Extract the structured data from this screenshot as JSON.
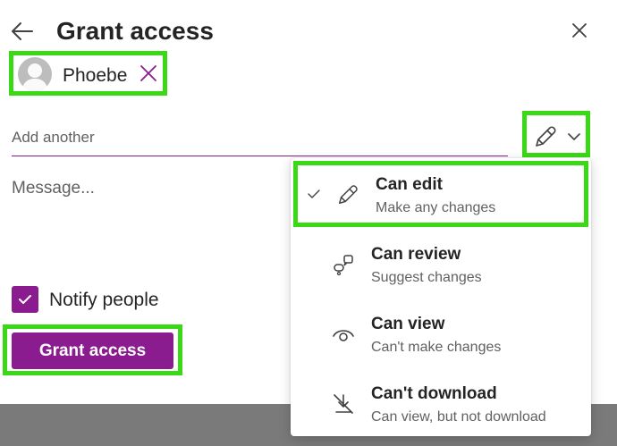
{
  "dialog": {
    "title": "Grant access",
    "back_icon": "arrow-left-icon",
    "close_icon": "close-icon"
  },
  "recipient": {
    "name": "Phoebe",
    "avatar_icon": "person-avatar-icon",
    "remove_icon": "remove-x-icon"
  },
  "add_input": {
    "placeholder": "Add another",
    "value": ""
  },
  "permission_button": {
    "icon": "pencil-icon",
    "dropdown_icon": "chevron-down-icon"
  },
  "message": {
    "placeholder": "Message...",
    "value": ""
  },
  "notify": {
    "label": "Notify people",
    "checked": true
  },
  "grant_button": {
    "label": "Grant access"
  },
  "permission_menu": {
    "items": [
      {
        "label": "Can edit",
        "description": "Make any changes",
        "icon": "pencil-icon",
        "selected": true
      },
      {
        "label": "Can review",
        "description": "Suggest changes",
        "icon": "review-shapes-icon",
        "selected": false
      },
      {
        "label": "Can view",
        "description": "Can't make changes",
        "icon": "eye-icon",
        "selected": false
      },
      {
        "label": "Can't download",
        "description": "Can view, but not download",
        "icon": "no-download-icon",
        "selected": false
      }
    ]
  },
  "colors": {
    "accent": "#8a1c8f",
    "highlight": "#3ad916"
  }
}
